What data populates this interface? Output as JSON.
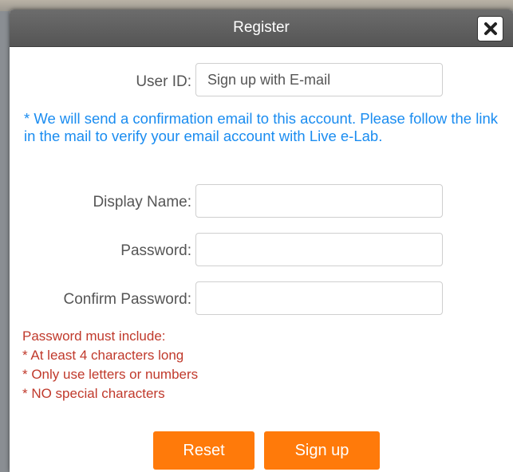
{
  "dialog": {
    "title": "Register",
    "close_icon": "close-icon"
  },
  "form": {
    "user_id": {
      "label": "User ID:",
      "placeholder": "Sign up with E-mail",
      "value": ""
    },
    "confirmation_notice": "* We will send a confirmation email to this account. Please follow the link in the mail to verify your email account with Live e-Lab.",
    "display_name": {
      "label": "Display Name:",
      "value": ""
    },
    "password": {
      "label": "Password:",
      "value": ""
    },
    "confirm_password": {
      "label": "Confirm Password:",
      "value": ""
    }
  },
  "password_rules": [
    "Password must include:",
    "* At least 4 characters long",
    "* Only use letters or numbers",
    "* NO special characters"
  ],
  "buttons": {
    "reset": "Reset",
    "sign_up": "Sign up"
  },
  "colors": {
    "titlebar": "#5f5f5f",
    "notice_text": "#1a8cf0",
    "rules_text": "#c0392b",
    "button_bg": "#ff7a0a"
  }
}
